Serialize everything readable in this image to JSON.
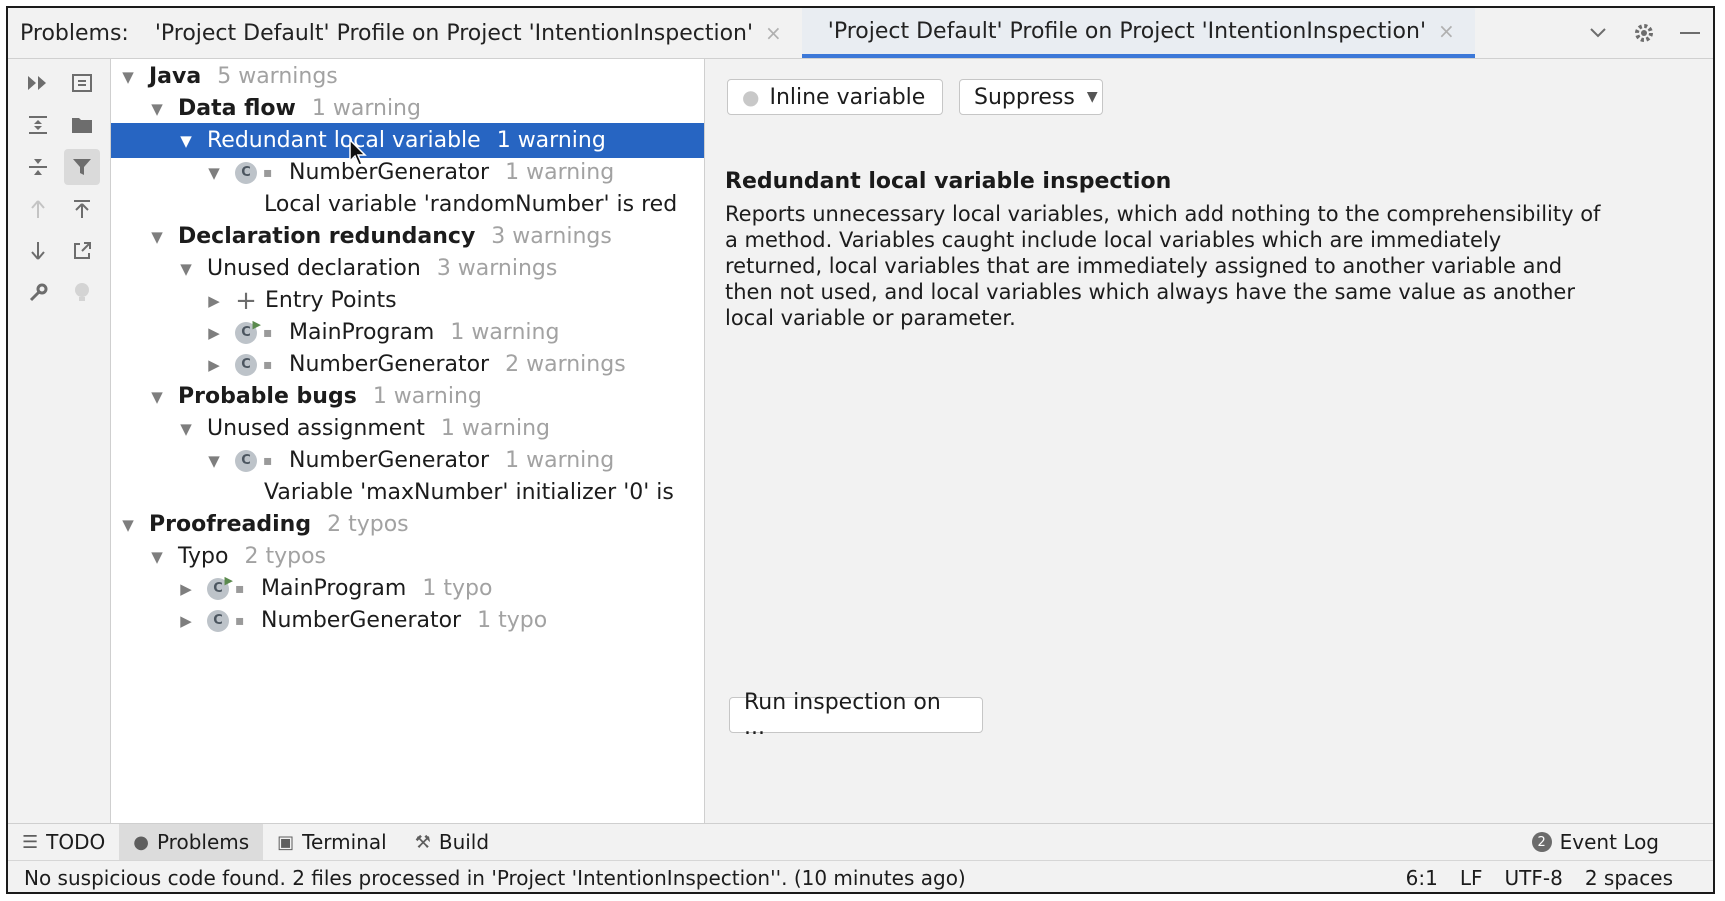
{
  "tabbar": {
    "label": "Problems:",
    "tabs": [
      {
        "label": "'Project Default' Profile on Project 'IntentionInspection'"
      },
      {
        "label": "'Project Default' Profile on Project 'IntentionInspection'"
      }
    ],
    "close_glyph": "×"
  },
  "tree": {
    "rows": [
      {
        "label": "Java",
        "count": "5 warnings"
      },
      {
        "label": "Data flow",
        "count": "1 warning"
      },
      {
        "label": "Redundant local variable",
        "count": "1 warning"
      },
      {
        "label": "NumberGenerator",
        "count": "1 warning"
      },
      {
        "label": "Local variable 'randomNumber' is red",
        "count": ""
      },
      {
        "label": "Declaration redundancy",
        "count": "3 warnings"
      },
      {
        "label": "Unused declaration",
        "count": "3 warnings"
      },
      {
        "label": "Entry Points",
        "count": ""
      },
      {
        "label": "MainProgram",
        "count": "1 warning"
      },
      {
        "label": "NumberGenerator",
        "count": "2 warnings"
      },
      {
        "label": "Probable bugs",
        "count": "1 warning"
      },
      {
        "label": "Unused assignment",
        "count": "1 warning"
      },
      {
        "label": "NumberGenerator",
        "count": "1 warning"
      },
      {
        "label": "Variable 'maxNumber' initializer '0' is",
        "count": ""
      },
      {
        "label": "Proofreading",
        "count": "2 typos"
      },
      {
        "label": "Typo",
        "count": "2 typos"
      },
      {
        "label": "MainProgram",
        "count": "1 typo"
      },
      {
        "label": "NumberGenerator",
        "count": "1 typo"
      }
    ],
    "class_glyph": "C"
  },
  "detail": {
    "fix_button": "Inline variable",
    "suppress_button": "Suppress",
    "title": "Redundant local variable inspection",
    "body": "Reports unnecessary local variables, which add nothing to the comprehensibility of a method. Variables caught include local variables which are immediately returned, local variables that are immediately assigned to another variable and then not used, and local variables which always have the same value as another local variable or parameter.",
    "run_button": "Run inspection on ..."
  },
  "bottombar": {
    "todo": "TODO",
    "problems": "Problems",
    "terminal": "Terminal",
    "build": "Build",
    "event_count": "2",
    "event_log": "Event Log"
  },
  "status": {
    "message": "No suspicious code found. 2 files processed in 'Project 'IntentionInspection''. (10 minutes ago)",
    "position": "6:1",
    "line_sep": "LF",
    "encoding": "UTF-8",
    "indent": "2 spaces"
  },
  "colors": {
    "selection": "#2765c2",
    "accent_underline": "#3c78d8"
  }
}
